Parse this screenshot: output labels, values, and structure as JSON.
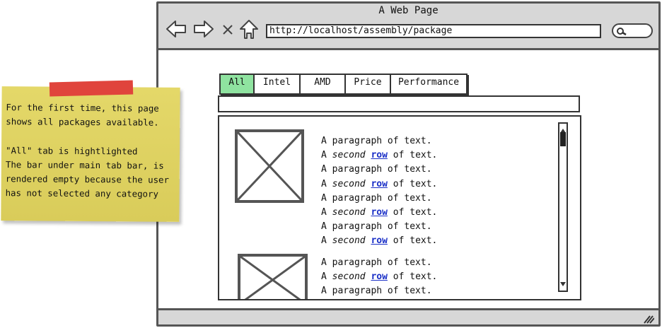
{
  "browser": {
    "title": "A Web Page",
    "url": "http://localhost/assembly/package"
  },
  "tabs": [
    {
      "label": "All",
      "active": true
    },
    {
      "label": "Intel",
      "active": false
    },
    {
      "label": "AMD",
      "active": false
    },
    {
      "label": "Price",
      "active": false
    },
    {
      "label": "Performance",
      "active": false
    }
  ],
  "items": [
    {
      "lines": [
        {
          "text": "A paragraph of text."
        },
        {
          "pre": "A ",
          "em": "second",
          "link": "row",
          "post": " of text."
        },
        {
          "text": "A paragraph of text."
        },
        {
          "pre": "A ",
          "em": "second",
          "link": "row",
          "post": " of text."
        },
        {
          "text": "A paragraph of text."
        },
        {
          "pre": "A ",
          "em": "second",
          "link": "row",
          "post": " of text."
        },
        {
          "text": "A paragraph of text."
        },
        {
          "pre": "A ",
          "em": "second",
          "link": "row",
          "post": " of text."
        }
      ]
    },
    {
      "lines": [
        {
          "text": "A paragraph of text."
        },
        {
          "pre": "A ",
          "em": "second",
          "link": "row",
          "post": " of text."
        },
        {
          "text": "A paragraph of text."
        }
      ]
    }
  ],
  "note": {
    "text": "For the first time, this page shows all packages available.\n\n\"All\" tab is hightlighted\nThe bar under main tab bar, is rendered empty because the user has not selected any category"
  },
  "colors": {
    "active_tab": "#8fe3a0",
    "note": "#e3d86a",
    "tape": "#e0443c",
    "link": "#1a2fc7"
  }
}
